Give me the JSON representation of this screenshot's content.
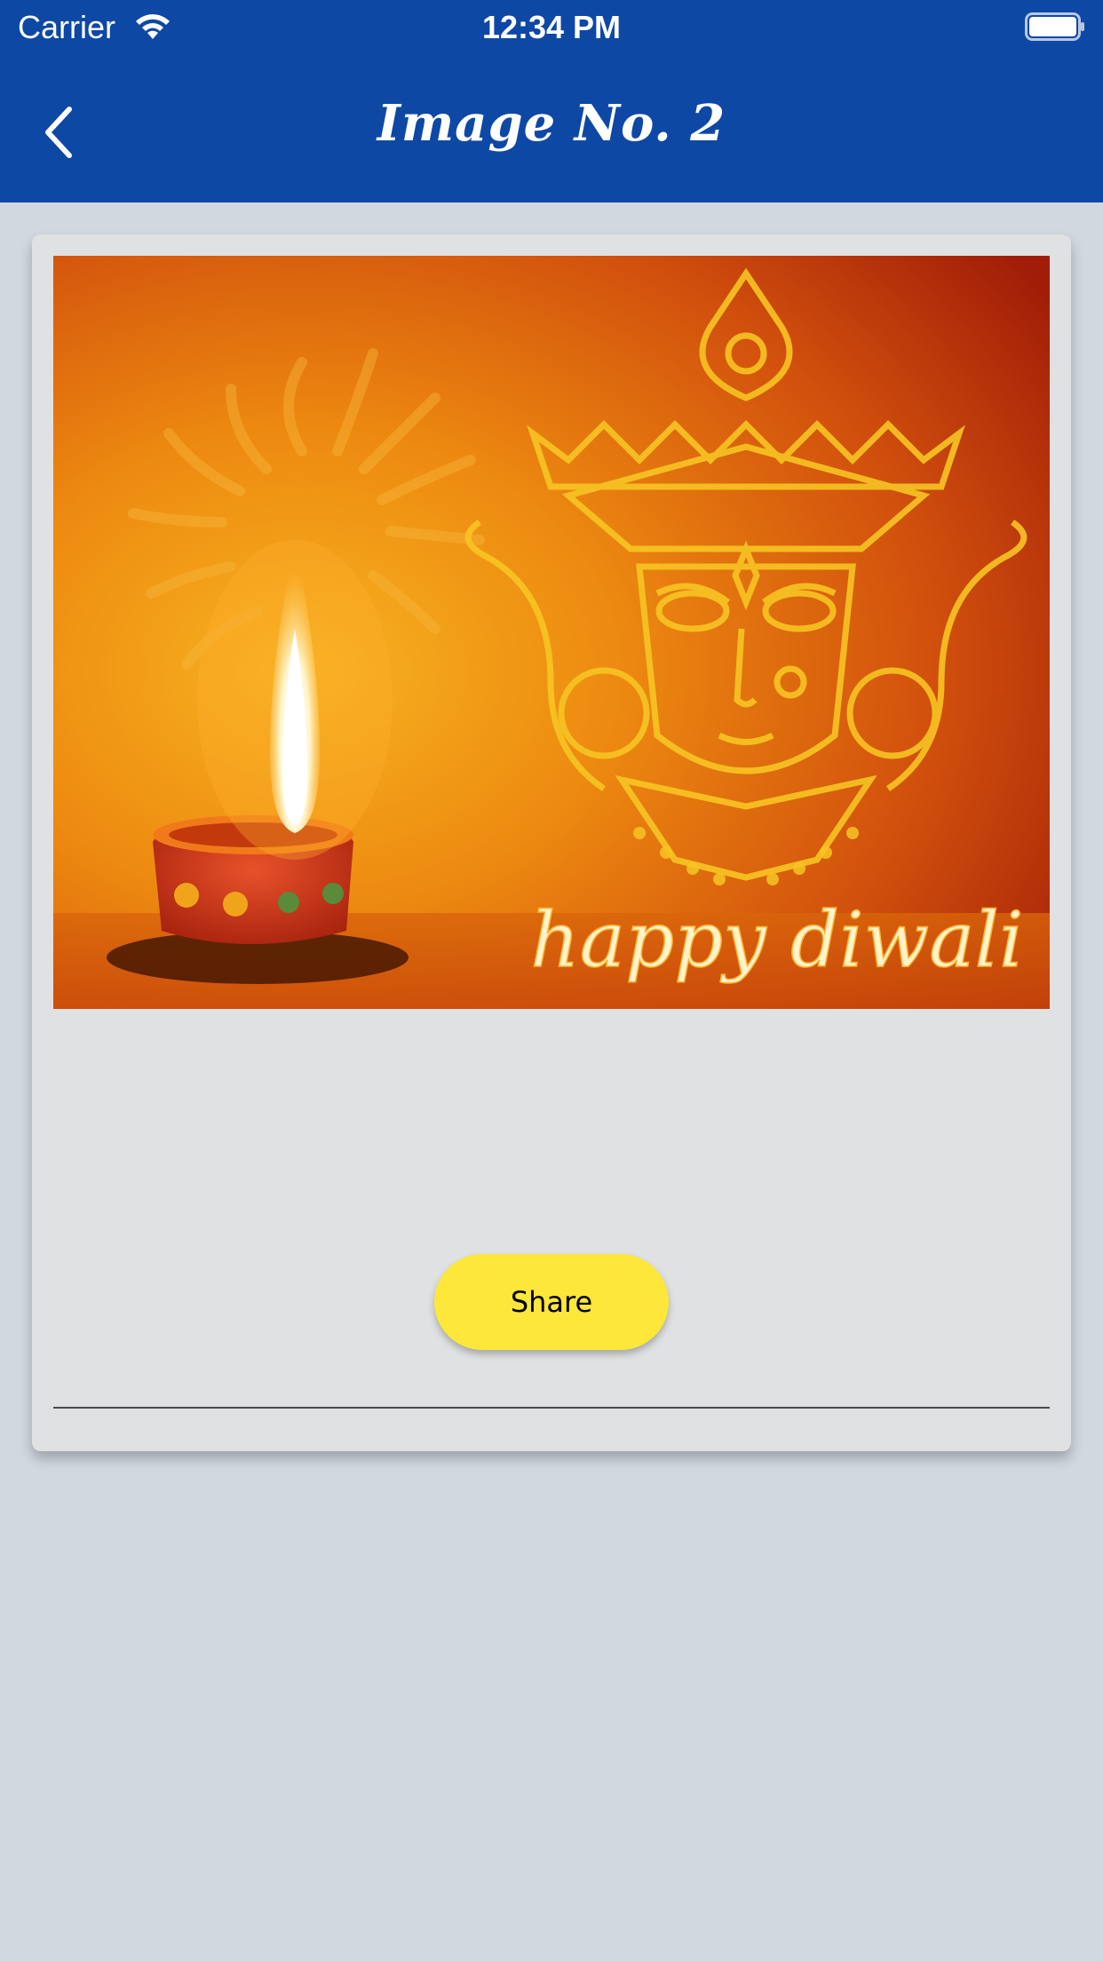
{
  "status_bar": {
    "carrier": "Carrier",
    "time": "12:34 PM",
    "icons": [
      "wifi-icon",
      "battery-icon"
    ]
  },
  "nav": {
    "title": "Image No. 2",
    "back_icon": "chevron-left-icon"
  },
  "card": {
    "image_caption": "happy diwali",
    "share_label": "Share"
  },
  "colors": {
    "nav_bar": "#0e48a5",
    "background": "#d1d8e0",
    "card": "#e0e1e2",
    "share_button": "#fde73a"
  }
}
